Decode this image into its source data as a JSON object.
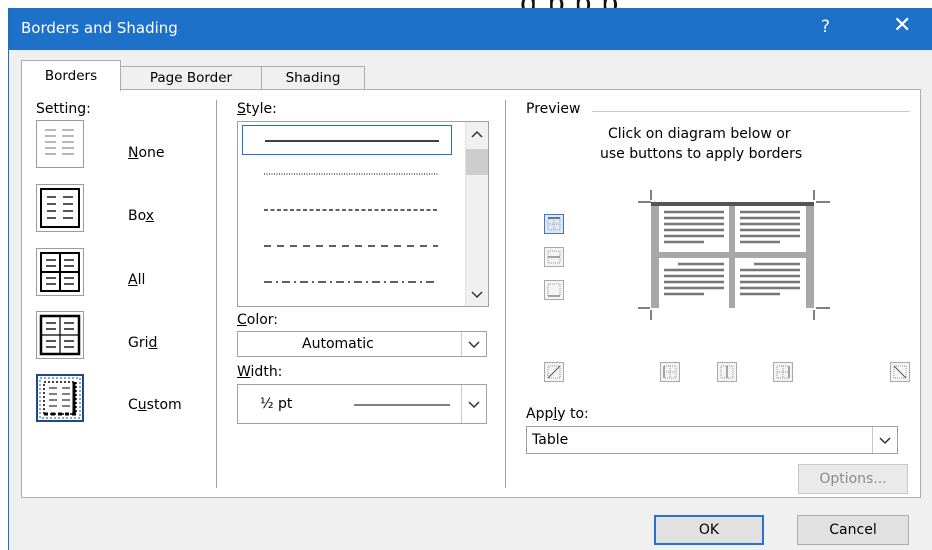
{
  "background_text": "g       p p p",
  "dialog": {
    "title": "Borders and Shading",
    "help_label": "?",
    "close_label": "✕"
  },
  "tabs": [
    {
      "label": "Borders",
      "active": true
    },
    {
      "label": "Page Border",
      "active": false
    },
    {
      "label": "Shading",
      "active": false
    }
  ],
  "setting": {
    "label": "Setting:",
    "options": [
      {
        "label": "None",
        "icon": "setting-none-icon",
        "selected": false
      },
      {
        "label": "Box",
        "icon": "setting-box-icon",
        "selected": false
      },
      {
        "label": "All",
        "icon": "setting-all-icon",
        "selected": false
      },
      {
        "label": "Grid",
        "icon": "setting-grid-icon",
        "selected": false
      },
      {
        "label": "Custom",
        "icon": "setting-custom-icon",
        "selected": true
      }
    ]
  },
  "style": {
    "label": "Style:",
    "items": [
      "solid",
      "dotted",
      "small-dash",
      "dash",
      "dash-dot"
    ],
    "selected_index": 0
  },
  "color": {
    "label": "Color:",
    "value": "Automatic"
  },
  "width": {
    "label": "Width:",
    "value": "½ pt"
  },
  "preview": {
    "label": "Preview",
    "instruction_line1": "Click on diagram below or",
    "instruction_line2": "use buttons to apply borders"
  },
  "apply_to": {
    "label": "Apply to:",
    "value": "Table"
  },
  "buttons": {
    "options": "Options...",
    "ok": "OK",
    "cancel": "Cancel"
  },
  "colors": {
    "title_bar": "#1d71c9",
    "accent": "#2a72c9"
  }
}
